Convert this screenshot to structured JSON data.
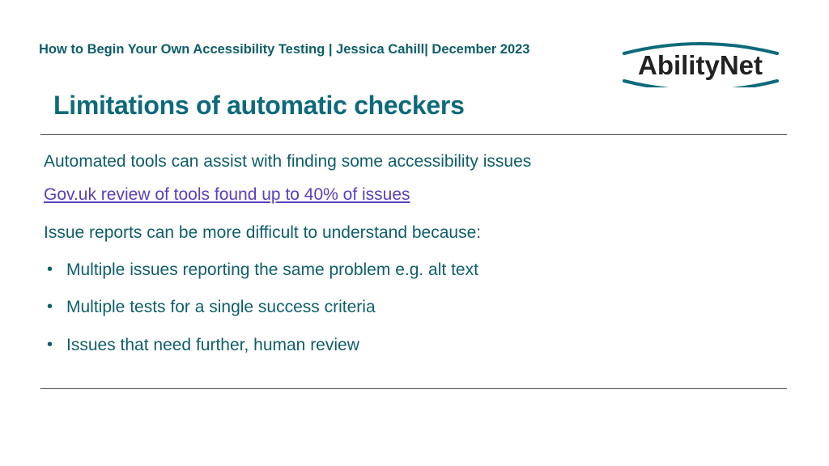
{
  "header": {
    "breadcrumb": "How to Begin Your Own Accessibility Testing | Jessica Cahill| December 2023",
    "logo_text": "AbilityNet"
  },
  "title": "Limitations of automatic checkers",
  "content": {
    "intro": "Automated tools can assist with finding some accessibility issues",
    "link_text": "Gov.uk review of tools found up to 40% of issues",
    "subhead": "Issue reports can be more difficult to understand because:",
    "bullets": [
      "Multiple issues reporting the same problem e.g. alt text",
      "Multiple tests for a single success criteria",
      "Issues that need further, human review"
    ]
  }
}
